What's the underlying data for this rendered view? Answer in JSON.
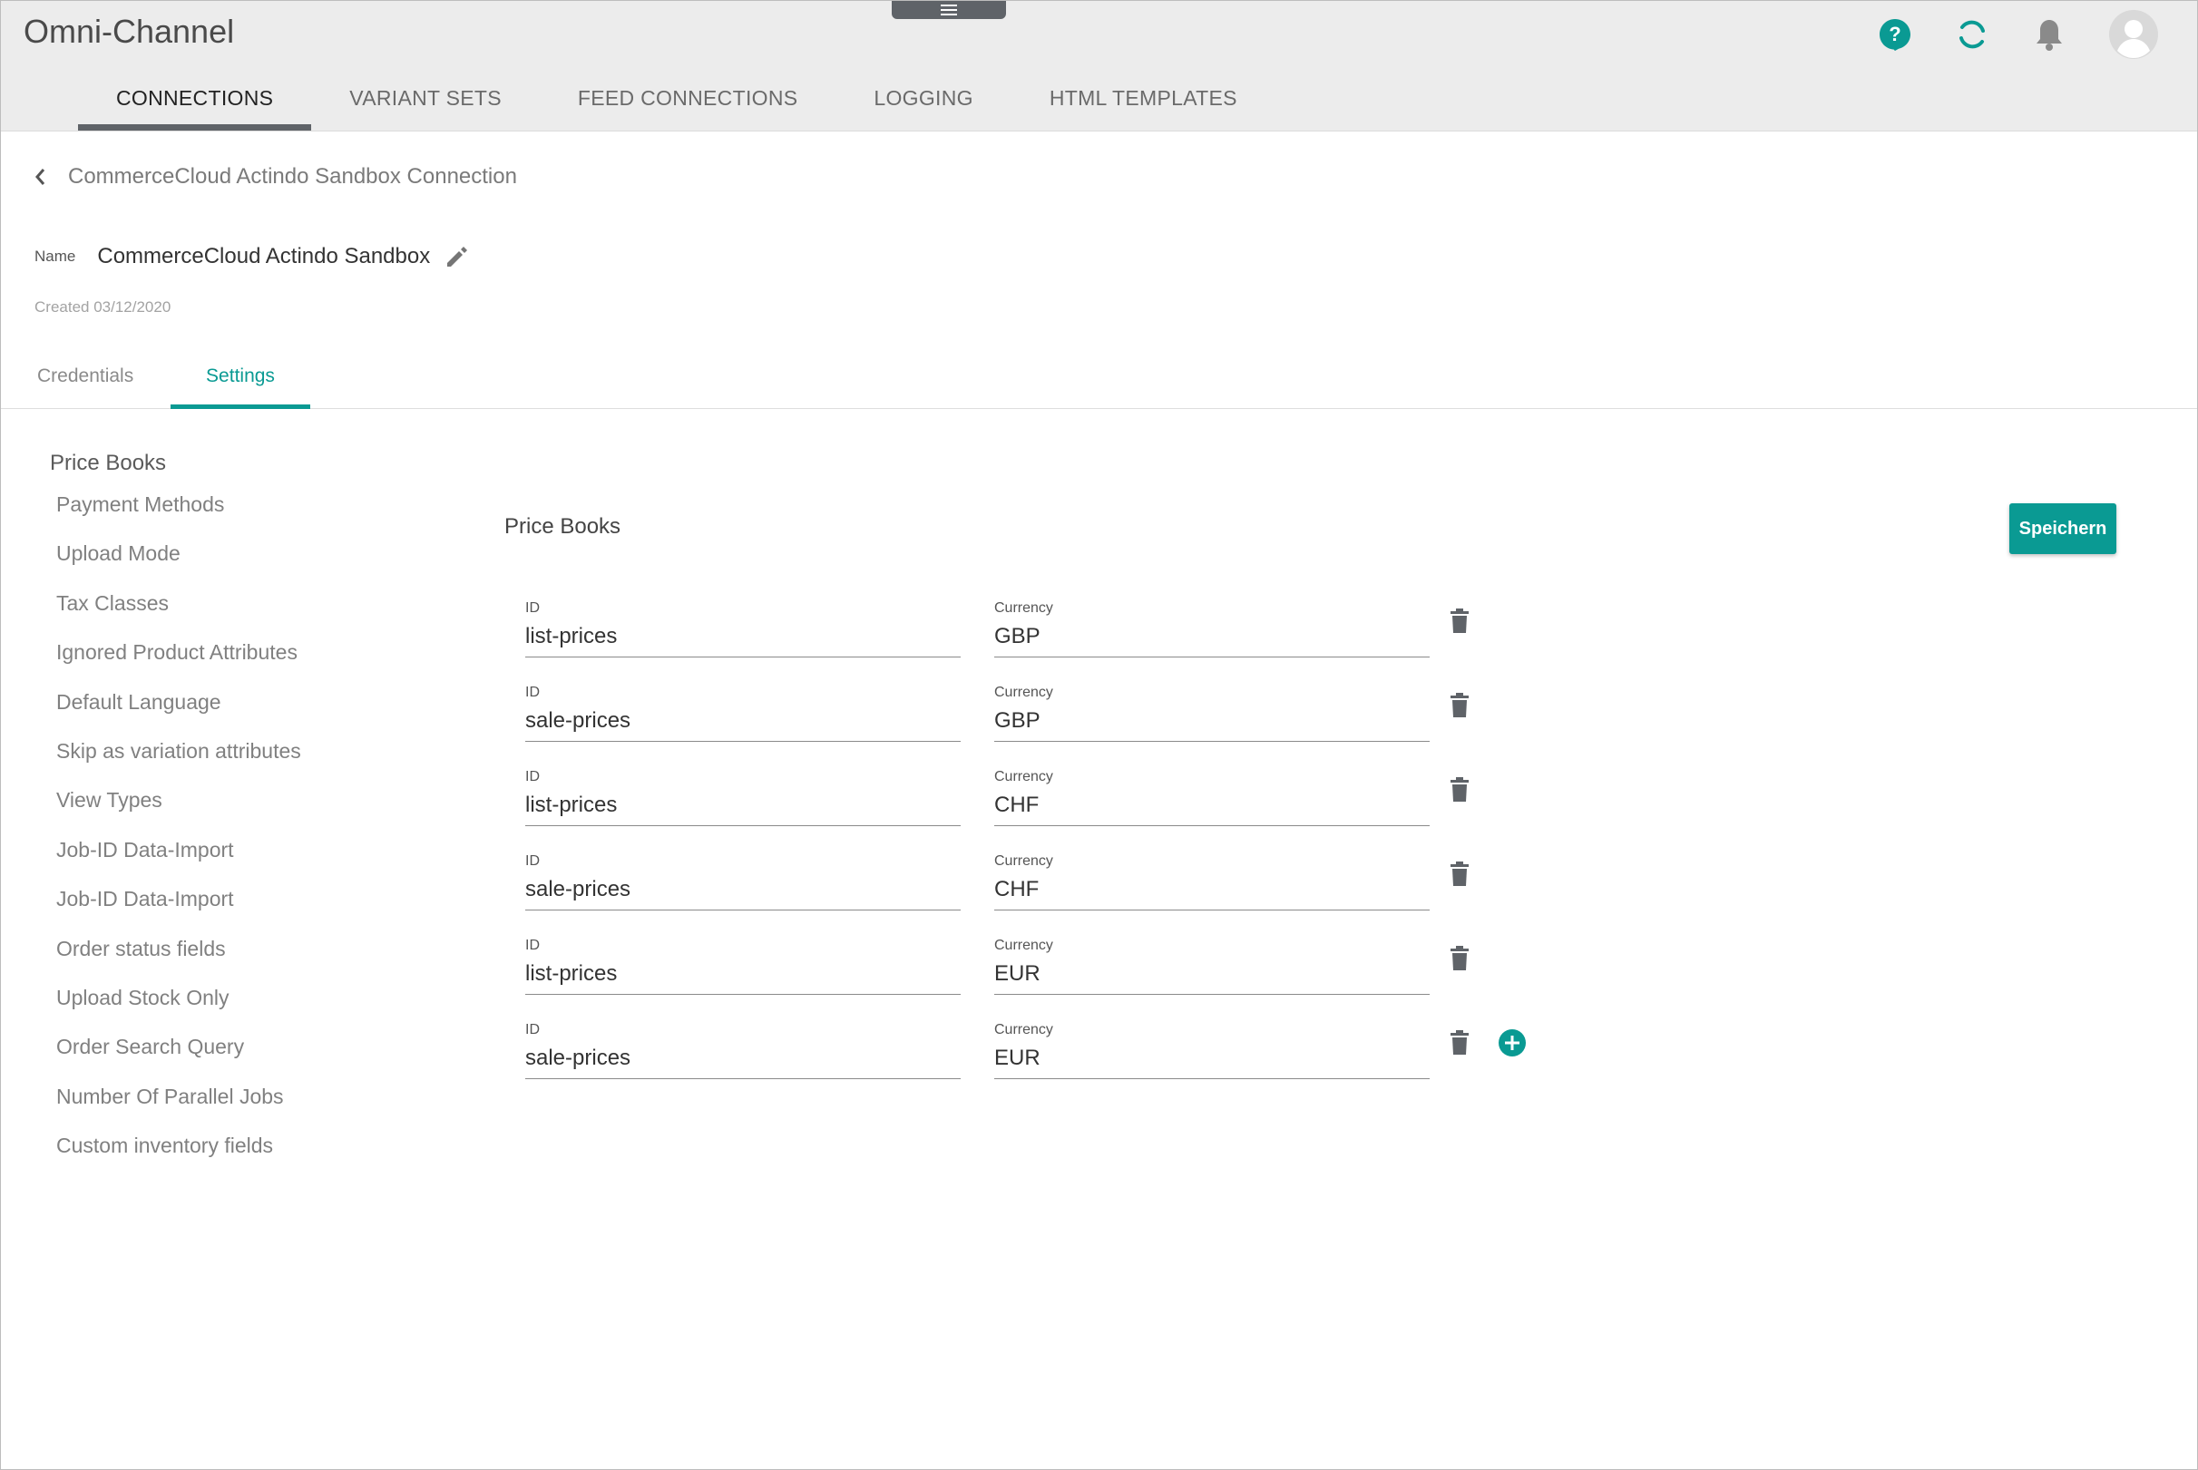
{
  "app": {
    "title": "Omni-Channel"
  },
  "header": {
    "icons": [
      "help-icon",
      "sync-icon",
      "bell-icon",
      "avatar-icon"
    ],
    "accent_color": "#0a9a93"
  },
  "nav": {
    "tabs": [
      {
        "label": "CONNECTIONS",
        "active": true
      },
      {
        "label": "VARIANT SETS"
      },
      {
        "label": "FEED CONNECTIONS"
      },
      {
        "label": "LOGGING"
      },
      {
        "label": "HTML TEMPLATES"
      }
    ]
  },
  "breadcrumb": {
    "title": "CommerceCloud Actindo Sandbox Connection"
  },
  "connection": {
    "name_label": "Name",
    "name_value": "CommerceCloud Actindo Sandbox",
    "created": "Created 03/12/2020"
  },
  "subtabs": {
    "credentials": "Credentials",
    "settings": "Settings",
    "active": "Settings"
  },
  "sidebar": {
    "title": "Price Books",
    "items": [
      "Payment Methods",
      "Upload Mode",
      "Tax Classes",
      "Ignored Product Attributes",
      "Default Language",
      "Skip as variation attributes",
      "View Types",
      "Job-ID Data-Import",
      "Job-ID Data-Import",
      "Order status fields",
      "Upload Stock Only",
      "Order Search Query",
      "Number Of Parallel Jobs",
      "Custom inventory fields"
    ]
  },
  "main": {
    "section_title": "Price Books",
    "save_label": "Speichern",
    "id_label": "ID",
    "currency_label": "Currency",
    "price_books": [
      {
        "id": "list-prices",
        "currency": "GBP"
      },
      {
        "id": "sale-prices",
        "currency": "GBP"
      },
      {
        "id": "list-prices",
        "currency": "CHF"
      },
      {
        "id": "sale-prices",
        "currency": "CHF"
      },
      {
        "id": "list-prices",
        "currency": "EUR"
      },
      {
        "id": "sale-prices",
        "currency": "EUR"
      }
    ]
  }
}
